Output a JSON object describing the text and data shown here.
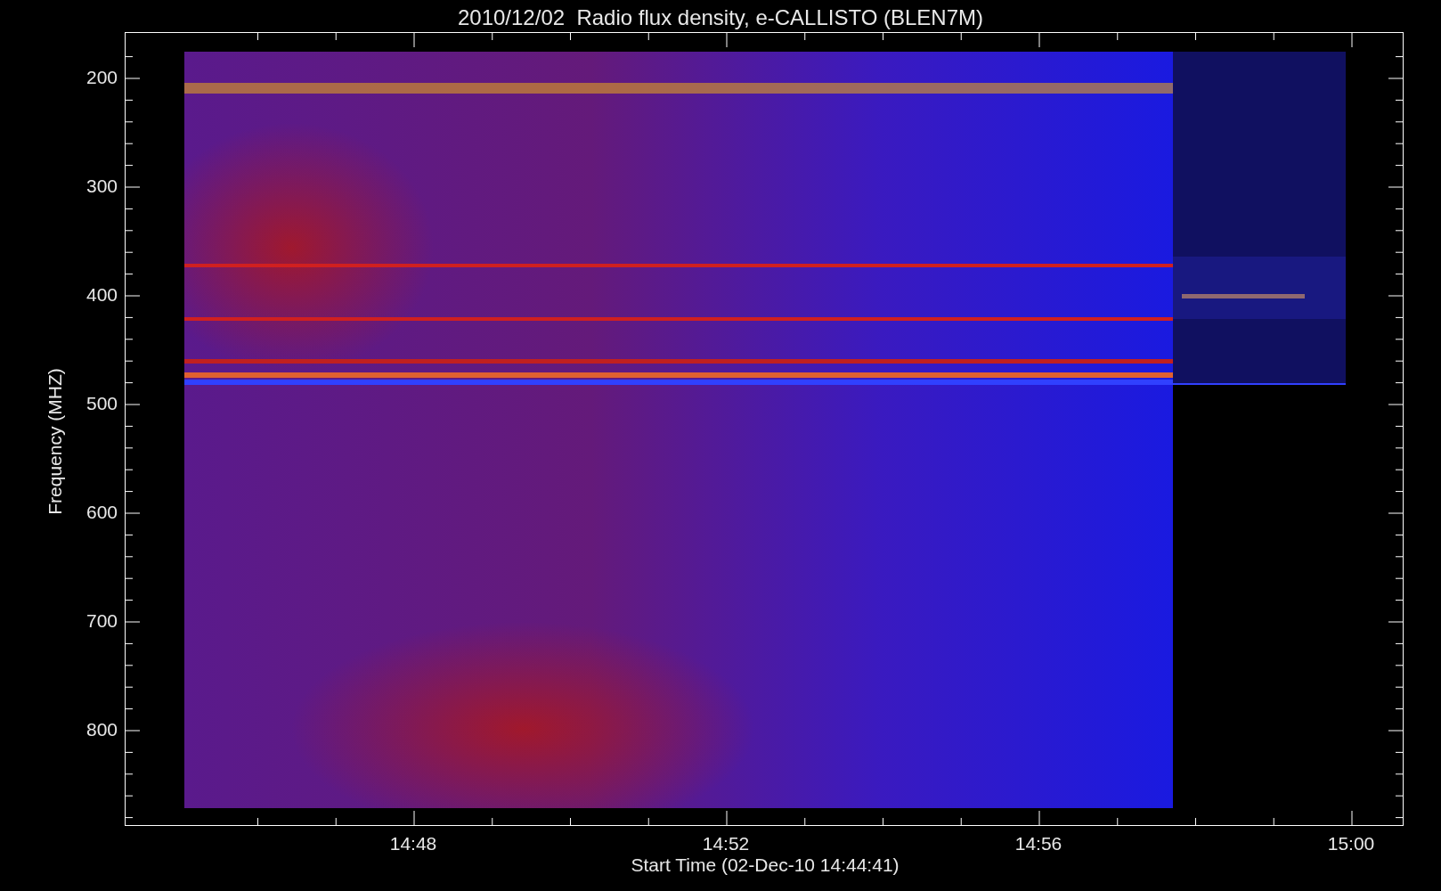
{
  "title": "2010/12/02  Radio flux density, e-CALLISTO (BLEN7M)",
  "y_axis": {
    "label": "Frequency (MHZ)",
    "ticks": [
      "200",
      "300",
      "400",
      "500",
      "600",
      "700",
      "800"
    ]
  },
  "x_axis": {
    "label": "Start Time (02-Dec-10 14:44:41)",
    "ticks": [
      "14:48",
      "14:52",
      "14:56",
      "15:00"
    ]
  }
}
